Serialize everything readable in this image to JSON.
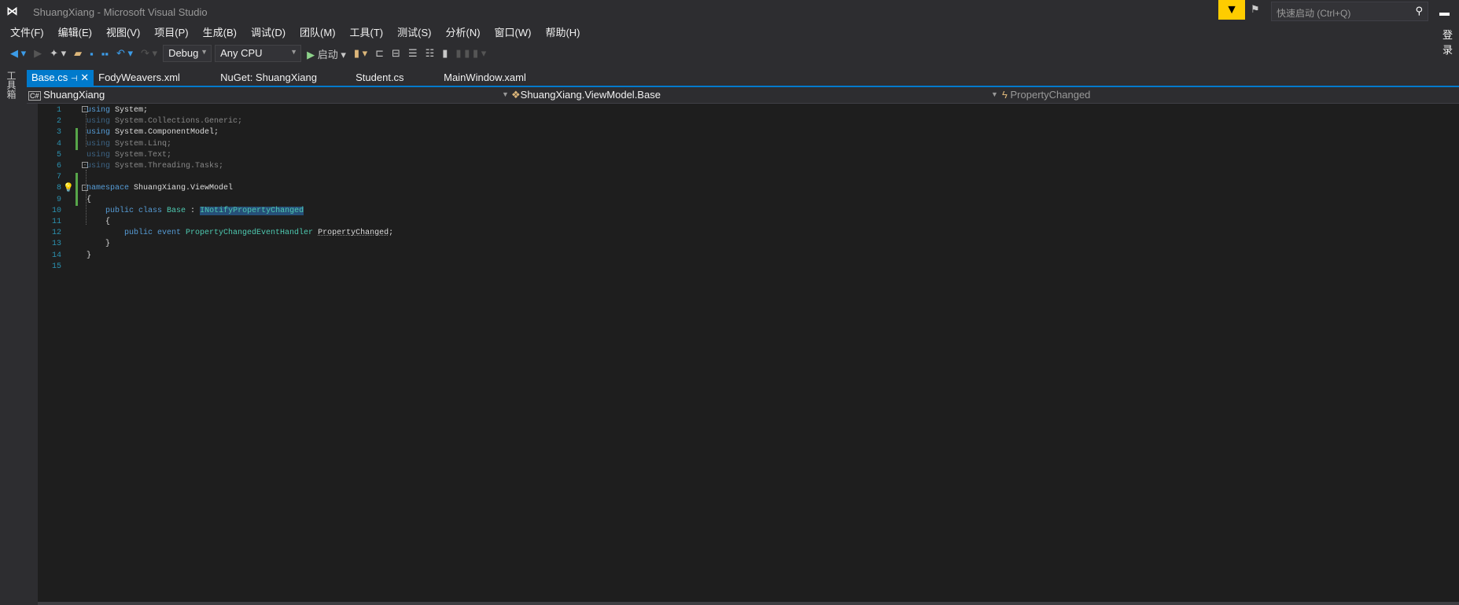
{
  "window": {
    "title": "ShuangXiang - Microsoft Visual Studio",
    "quick_launch_placeholder": "快速启动 (Ctrl+Q)",
    "login": "登录"
  },
  "menu": [
    "文件(F)",
    "编辑(E)",
    "视图(V)",
    "项目(P)",
    "生成(B)",
    "调试(D)",
    "团队(M)",
    "工具(T)",
    "测试(S)",
    "分析(N)",
    "窗口(W)",
    "帮助(H)"
  ],
  "toolbar": {
    "configuration": "Debug",
    "platform": "Any CPU",
    "start": "启动"
  },
  "side_panel": "工具箱",
  "tabs": [
    {
      "label": "Base.cs",
      "active": true
    },
    {
      "label": "FodyWeavers.xml"
    },
    {
      "label": "NuGet: ShuangXiang"
    },
    {
      "label": "Student.cs"
    },
    {
      "label": "MainWindow.xaml"
    }
  ],
  "navbar": {
    "project": "ShuangXiang",
    "type": "ShuangXiang.ViewModel.Base",
    "member": "PropertyChanged"
  },
  "code": {
    "l1": [
      "using",
      " System;"
    ],
    "l2": [
      "using",
      " System.Collections.Generic;"
    ],
    "l3": [
      "using",
      " System.ComponentModel;"
    ],
    "l4": [
      "using",
      " System.Linq;"
    ],
    "l5": [
      "using",
      " System.Text;"
    ],
    "l6": [
      "using",
      " System.Threading.Tasks;"
    ],
    "l8": [
      "namespace",
      " ShuangXiang.ViewModel"
    ],
    "l9": "{",
    "l10": [
      "public class ",
      "Base",
      " : ",
      "INotifyPropertyChanged"
    ],
    "l11": "{",
    "l12": [
      "public event ",
      "PropertyChangedEventHandler",
      " ",
      "PropertyChanged",
      ";"
    ],
    "l13": "}",
    "l14": "}",
    "line_numbers": [
      "1",
      "2",
      "3",
      "4",
      "5",
      "6",
      "7",
      "8",
      "9",
      "10",
      "11",
      "12",
      "13",
      "14",
      "15"
    ]
  },
  "colors": {
    "accent": "#007acc",
    "keyword": "#569cd6",
    "type": "#4ec9b0",
    "editor_bg": "#1e1e1e",
    "notification": "#fecc00"
  }
}
